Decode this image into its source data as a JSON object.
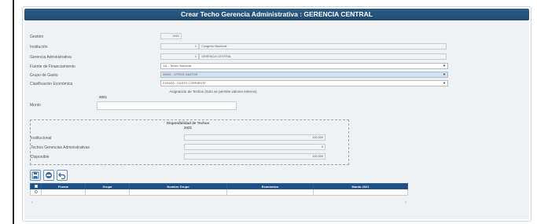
{
  "header": {
    "title": "Crear Techo Gerencia Administrativa : GERENCIA CENTRAL"
  },
  "form": {
    "gestion": {
      "label": "Gestión",
      "value": "2021"
    },
    "institucion": {
      "label": "Institución",
      "code": "1",
      "value": "Congreso Nacional"
    },
    "gerencia": {
      "label": "Gerencia Administrativa",
      "code": "1",
      "value": "GERENCIA CENTRAL"
    },
    "fuente": {
      "label": "Fuente de Financiamiento",
      "value": "111 - Tesoro Nacional"
    },
    "grupo": {
      "label": "Grupo de Gasto",
      "value": "00000 - OTROS GASTOS"
    },
    "clasificacion": {
      "label": "Clasificación Económica",
      "value": "2100000 - GASTO CORRIENTE"
    }
  },
  "asignacion": {
    "title": "Asignación de Techos (Solo se permite valores enteros)",
    "year": "2021",
    "monto_label": "Monto",
    "monto_value": ""
  },
  "disponibilidad": {
    "title": "Disponibilidad de Techos",
    "year": "2021",
    "rows": [
      {
        "label": "Institucional",
        "value": "100,000"
      },
      {
        "label": "Techos Gerencias Administrativas",
        "value": "0"
      },
      {
        "label": "Disponible",
        "value": "100,000"
      }
    ]
  },
  "toolbar": {
    "icons": [
      "save-icon",
      "cancel-icon",
      "undo-icon"
    ],
    "colors": {
      "accent": "#3a6ea5",
      "header": "#1e4f86"
    }
  },
  "table": {
    "columns": [
      "",
      "Fuente",
      "Grupo",
      "Nombre Grupo",
      "Económico",
      "Monto 2021"
    ],
    "scroll_left": "‹",
    "scroll_right": "›"
  }
}
